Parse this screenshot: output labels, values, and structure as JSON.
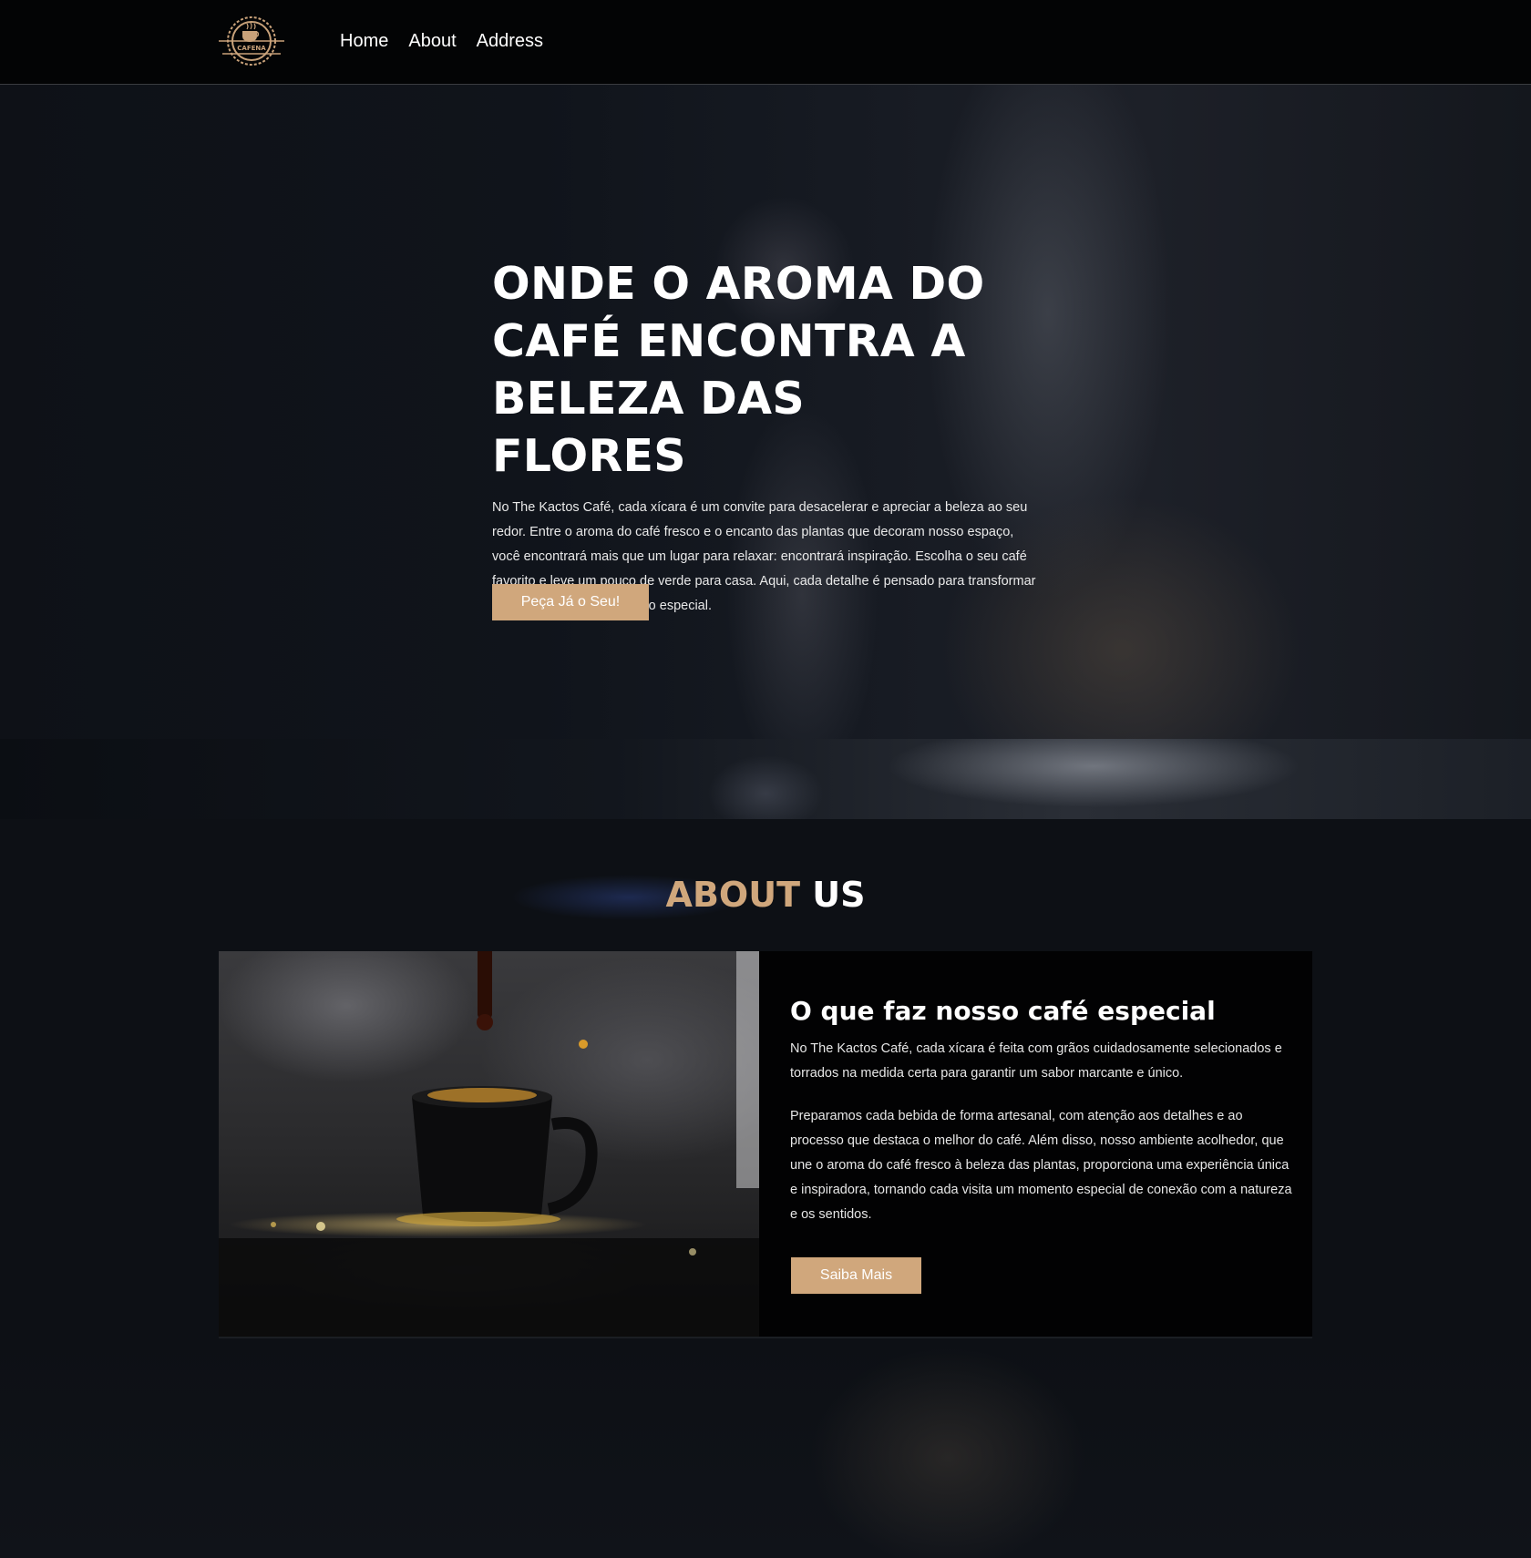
{
  "brand": {
    "logo_text": "CAFENA"
  },
  "nav": [
    {
      "label": "Home"
    },
    {
      "label": "About"
    },
    {
      "label": "Address"
    }
  ],
  "hero": {
    "title": "ONDE O AROMA DO CAFÉ ENCONTRA A BELEZA DAS FLORES",
    "text": "No The Kactos Café, cada xícara é um convite para desacelerar e apreciar a beleza ao seu redor. Entre o aroma do café fresco e o encanto das plantas que decoram nosso espaço, você encontrará mais que um lugar para relaxar: encontrará inspiração. Escolha o seu café favorito e leve um pouco de verde para casa. Aqui, cada detalhe é pensado para transformar sua pausa em um momento especial.",
    "button": "Peça Já o Seu!"
  },
  "about": {
    "heading_accent": "ABOUT",
    "heading_rest": "US",
    "title": "O que faz nosso café especial",
    "paragraph1": "No The Kactos Café, cada xícara é feita com grãos cuidadosamente selecionados e torrados na medida certa para garantir um sabor marcante e único.",
    "paragraph2": "Preparamos cada bebida de forma artesanal, com atenção aos detalhes e ao processo que destaca o melhor do café. Além disso, nosso ambiente acolhedor, que une o aroma do café fresco à beleza das plantas, proporciona uma experiência única e inspiradora, tornando cada visita um momento especial de conexão com a natureza e os sentidos.",
    "button": "Saiba Mais"
  },
  "colors": {
    "accent": "#d0a77c",
    "header_bg": "#030405",
    "page_bg": "#0d1015"
  }
}
